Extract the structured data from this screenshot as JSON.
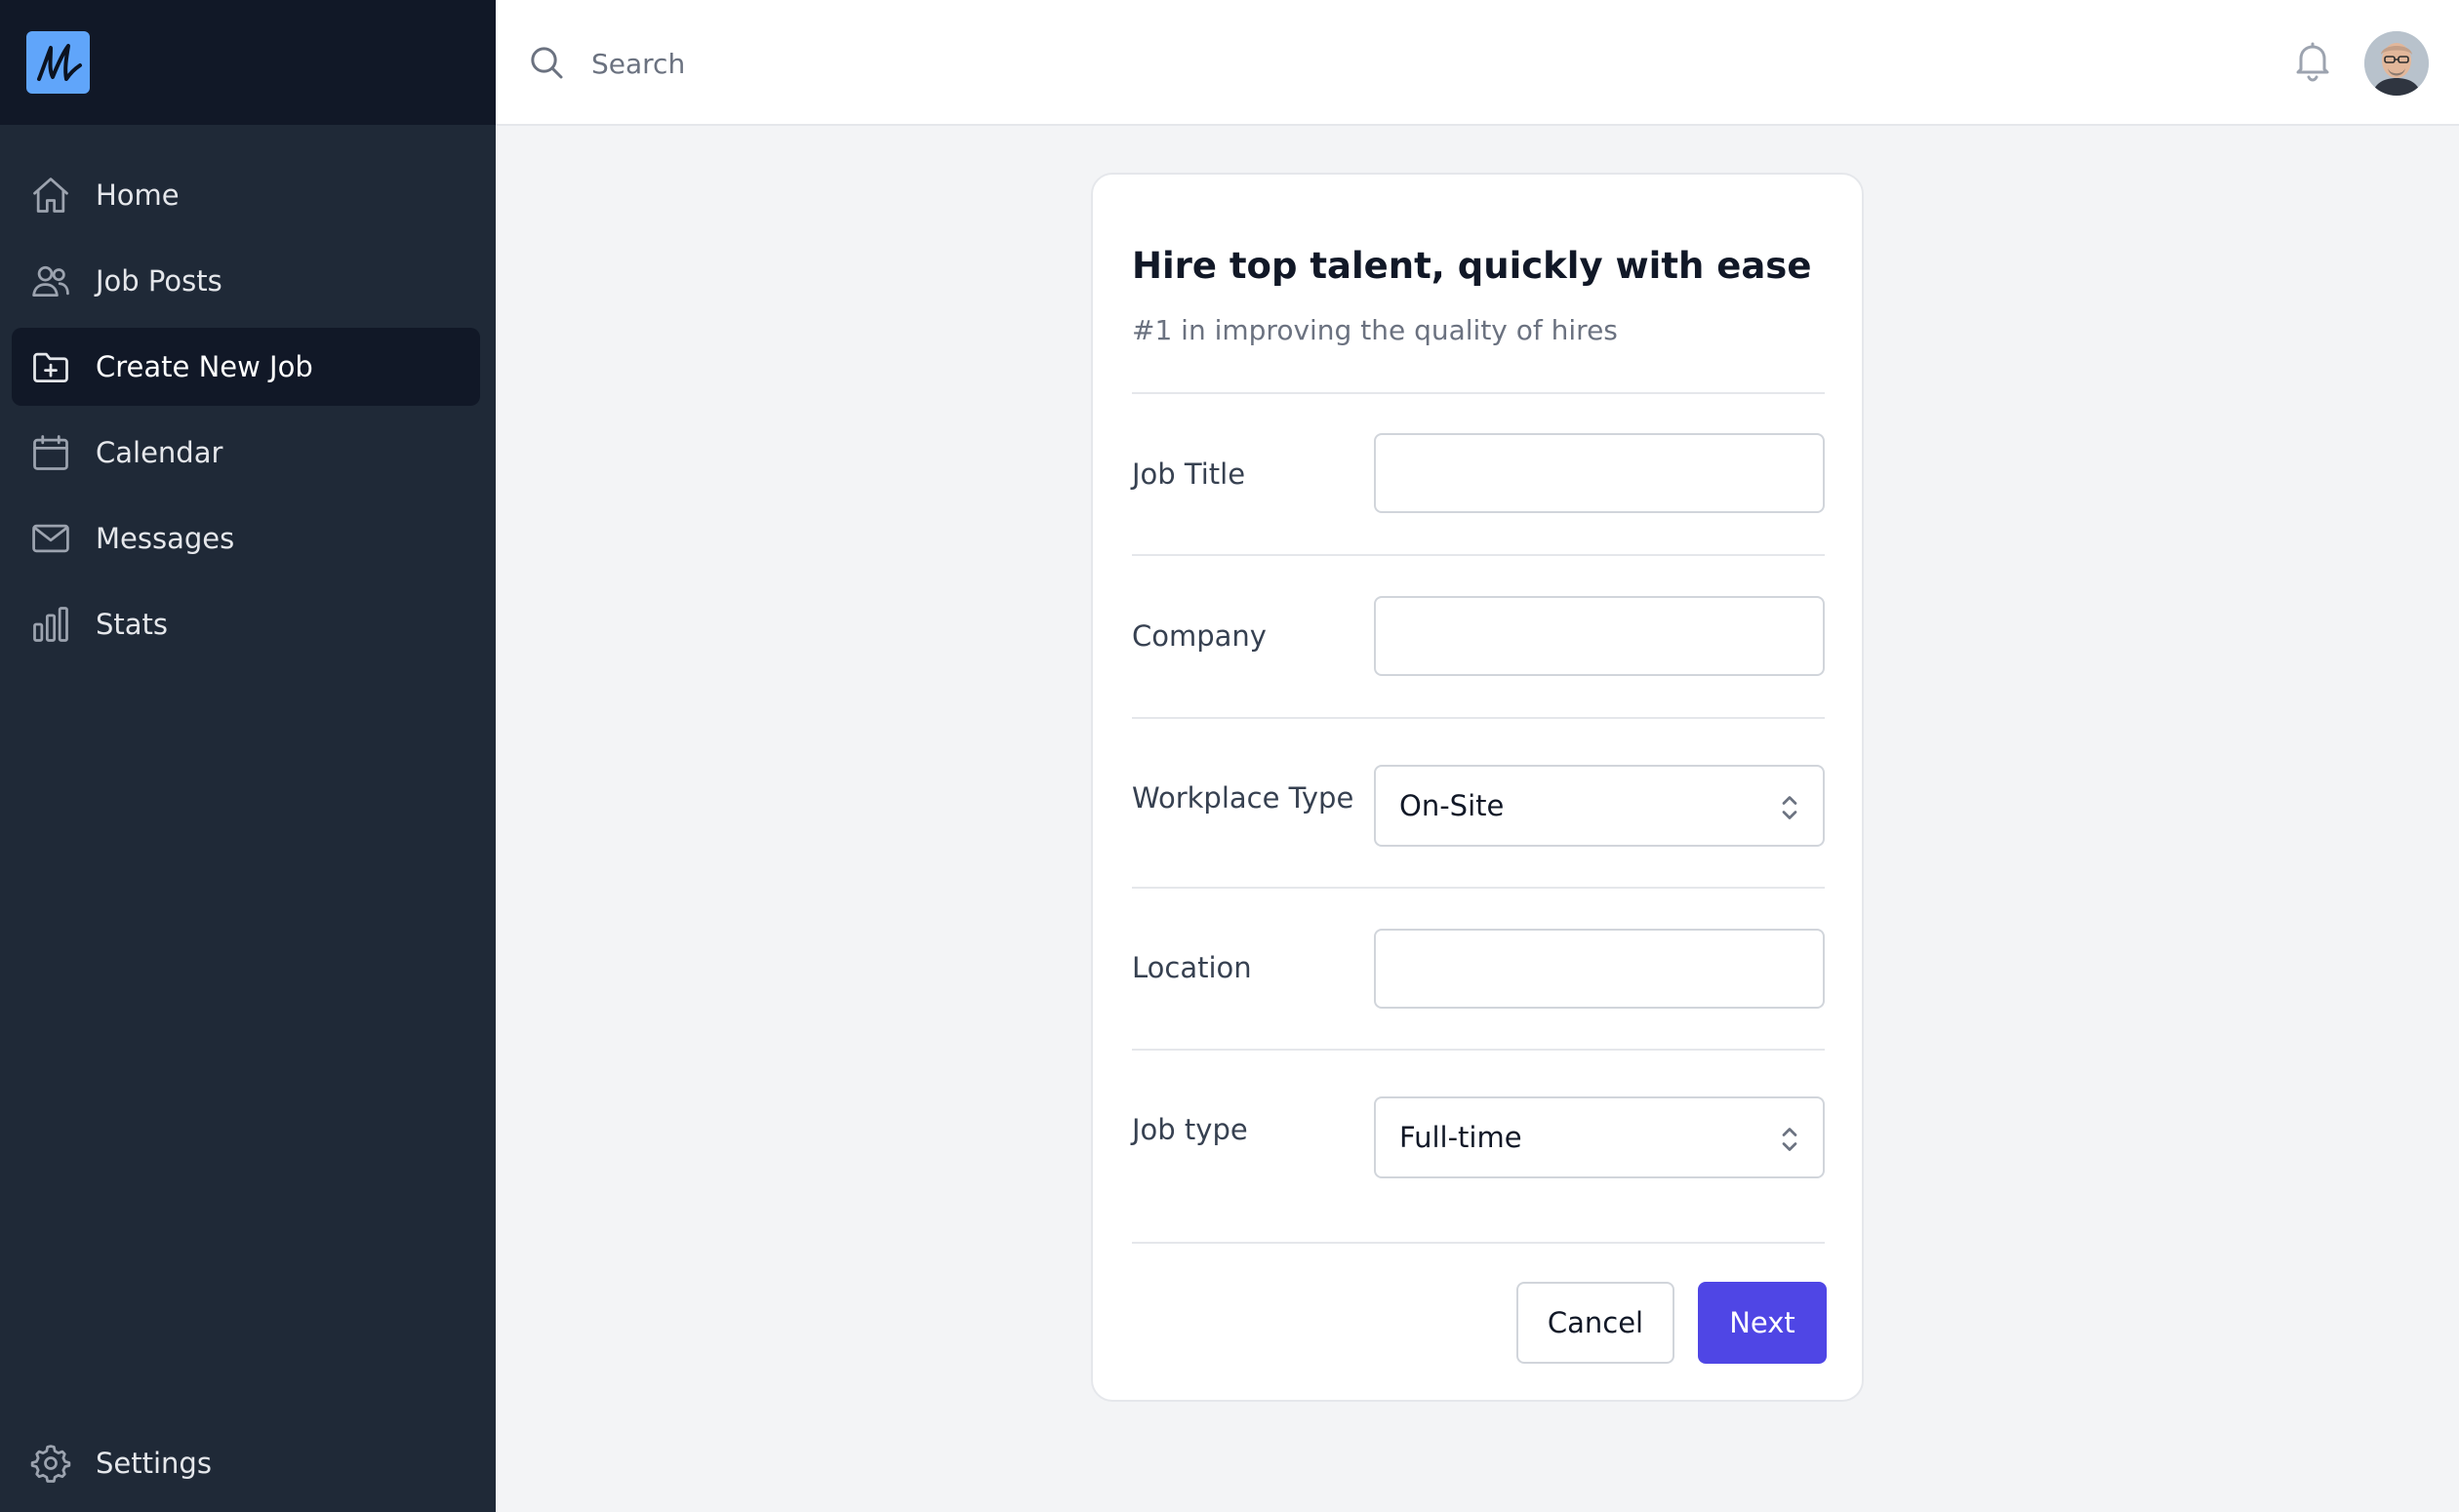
{
  "sidebar": {
    "logo_icon": "signature-logo-icon",
    "items": [
      {
        "label": "Home",
        "icon": "home-icon"
      },
      {
        "label": "Job Posts",
        "icon": "users-icon"
      },
      {
        "label": "Create New Job",
        "icon": "folder-plus-icon",
        "active": true
      },
      {
        "label": "Calendar",
        "icon": "calendar-icon"
      },
      {
        "label": "Messages",
        "icon": "mail-icon"
      },
      {
        "label": "Stats",
        "icon": "bar-chart-icon"
      }
    ],
    "settings": {
      "label": "Settings",
      "icon": "gear-icon"
    }
  },
  "topbar": {
    "search_placeholder": "Search",
    "notification_icon": "bell-icon",
    "avatar": "user-avatar"
  },
  "form": {
    "title": "Hire top talent, quickly with ease",
    "subtitle": "#1 in improving the quality of hires",
    "fields": {
      "job_title": {
        "label": "Job Title",
        "value": ""
      },
      "company": {
        "label": "Company",
        "value": ""
      },
      "workplace_type": {
        "label": "Workplace Type",
        "value": "On-Site"
      },
      "location": {
        "label": "Location",
        "value": ""
      },
      "job_type": {
        "label": "Job type",
        "value": "Full-time"
      }
    },
    "cancel_label": "Cancel",
    "next_label": "Next"
  },
  "colors": {
    "sidebar_bg": "#1f2937",
    "sidebar_top_bg": "#111827",
    "accent": "#4f46e5",
    "logo_bg": "#60a5fa",
    "page_bg": "#f3f4f6"
  }
}
